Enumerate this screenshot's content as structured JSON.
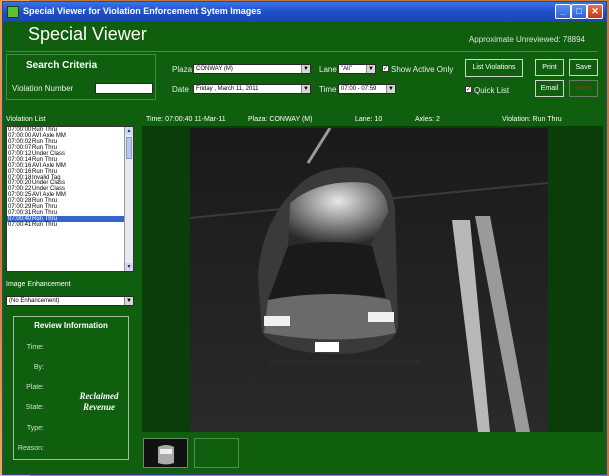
{
  "window": {
    "title": "Special Viewer for Violation Enforcement Sytem Images"
  },
  "header": {
    "app_title": "Special Viewer",
    "unreviewed_label": "Approximate Unreviewed:",
    "unreviewed_count": "78894"
  },
  "search": {
    "title": "Search Criteria",
    "violation_number_label": "Violation Number",
    "violation_number_value": "",
    "plaza_label": "Plaza",
    "plaza_value": "CONWAY (M)",
    "lane_label": "Lane",
    "lane_value": "\"All\"",
    "show_active_label": "Show Active Only",
    "show_active_checked": true,
    "date_label": "Date",
    "date_value": "Friday  ,  March  11, 2011",
    "time_label": "Time",
    "time_value": "07:00 - 07:59",
    "quick_list_label": "Quick List",
    "quick_list_checked": true
  },
  "buttons": {
    "list_violations": "List Violations",
    "print": "Print",
    "save": "Save",
    "email": "Email",
    "next": "Next"
  },
  "info_bar": {
    "time": "Time:  07:00:40 11-Mar-11",
    "plaza": "Plaza:  CONWAY (M)",
    "lane": "Lane:  10",
    "axles": "Axles:  2",
    "violation": "Violation:  Run Thru"
  },
  "violation_list": {
    "title": "Violation List",
    "items": [
      {
        "time": "07:00:00",
        "type": "Run Thru"
      },
      {
        "time": "07:00:00",
        "type": "AVI Axle MM"
      },
      {
        "time": "07:00:02",
        "type": "Run Thru"
      },
      {
        "time": "07:00:07",
        "type": "Run Thru"
      },
      {
        "time": "07:00:12",
        "type": "Under Class"
      },
      {
        "time": "07:00:14",
        "type": "Run Thru"
      },
      {
        "time": "07:00:16",
        "type": "AVI Axle MM"
      },
      {
        "time": "07:00:16",
        "type": "Run Thru"
      },
      {
        "time": "07:00:18",
        "type": "Invalid Tag"
      },
      {
        "time": "07:00:20",
        "type": "Under Class"
      },
      {
        "time": "07:00:22",
        "type": "Under Class"
      },
      {
        "time": "07:00:25",
        "type": "AVI Axle MM"
      },
      {
        "time": "07:00:28",
        "type": "Run Thru"
      },
      {
        "time": "07:00:29",
        "type": "Run Thru"
      },
      {
        "time": "07:00:31",
        "type": "Run Thru"
      },
      {
        "time": "07:00:40",
        "type": "Run Thru"
      },
      {
        "time": "07:00:41",
        "type": "Run Thru"
      }
    ],
    "selected_index": 15
  },
  "enhancement": {
    "title": "Image Enhancement",
    "value": "(No Enhancement)"
  },
  "review": {
    "title": "Review Information",
    "labels": {
      "time": "Time:",
      "by": "By:",
      "plate": "Plate:",
      "state": "State:",
      "type": "Type:",
      "reason": "Reason:"
    },
    "watermark_line1": "Reclaimed",
    "watermark_line2": "Revenue"
  },
  "colors": {
    "panel": "#0f5f0f",
    "titlebar": "#1f4fc8",
    "selection": "#3366cc",
    "edge": "#d07a3a"
  },
  "icons": {
    "minimize": "minimize-icon",
    "maximize": "maximize-icon",
    "close": "close-icon",
    "dropdown": "chevron-down-icon",
    "check": "checkmark-icon"
  }
}
